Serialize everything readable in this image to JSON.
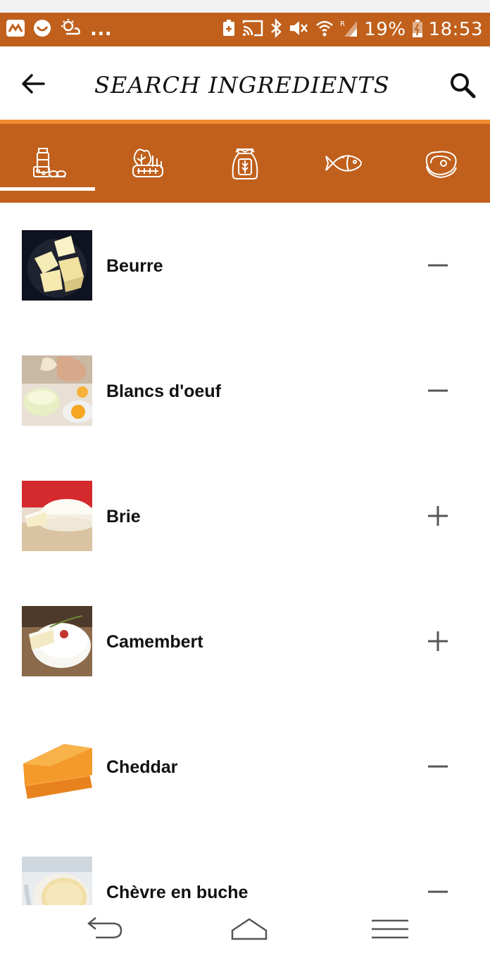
{
  "status_bar": {
    "battery_percent": "19%",
    "time": "18:53",
    "overflow": "...",
    "icons": [
      "maps-icon",
      "messenger-icon",
      "weather-icon",
      "battery-saver-icon",
      "cast-icon",
      "bluetooth-icon",
      "vibrate-icon",
      "wifi-icon",
      "signal-icon",
      "battery-icon"
    ]
  },
  "app_bar": {
    "title": "SEARCH INGREDIENTS",
    "back_icon": "arrow-left-icon",
    "search_icon": "search-icon"
  },
  "category_tabs": [
    {
      "name": "dairy",
      "icon": "dairy-icon",
      "selected": true
    },
    {
      "name": "vegetables",
      "icon": "vegetables-icon",
      "selected": false
    },
    {
      "name": "grains",
      "icon": "flour-sack-icon",
      "selected": false
    },
    {
      "name": "fish",
      "icon": "fish-icon",
      "selected": false
    },
    {
      "name": "meat",
      "icon": "steak-icon",
      "selected": false
    }
  ],
  "ingredients": [
    {
      "name": "Beurre",
      "action": "remove"
    },
    {
      "name": "Blancs d'oeuf",
      "action": "remove"
    },
    {
      "name": "Brie",
      "action": "add"
    },
    {
      "name": "Camembert",
      "action": "add"
    },
    {
      "name": "Cheddar",
      "action": "remove"
    },
    {
      "name": "Chèvre en buche",
      "action": "remove"
    }
  ],
  "colors": {
    "primary": "#c0601c",
    "accent_line": "#f28a2e",
    "text": "#111111",
    "toggle": "#555555"
  },
  "nav_bar": {
    "icons": [
      "back-nav-icon",
      "home-nav-icon",
      "menu-nav-icon"
    ]
  }
}
